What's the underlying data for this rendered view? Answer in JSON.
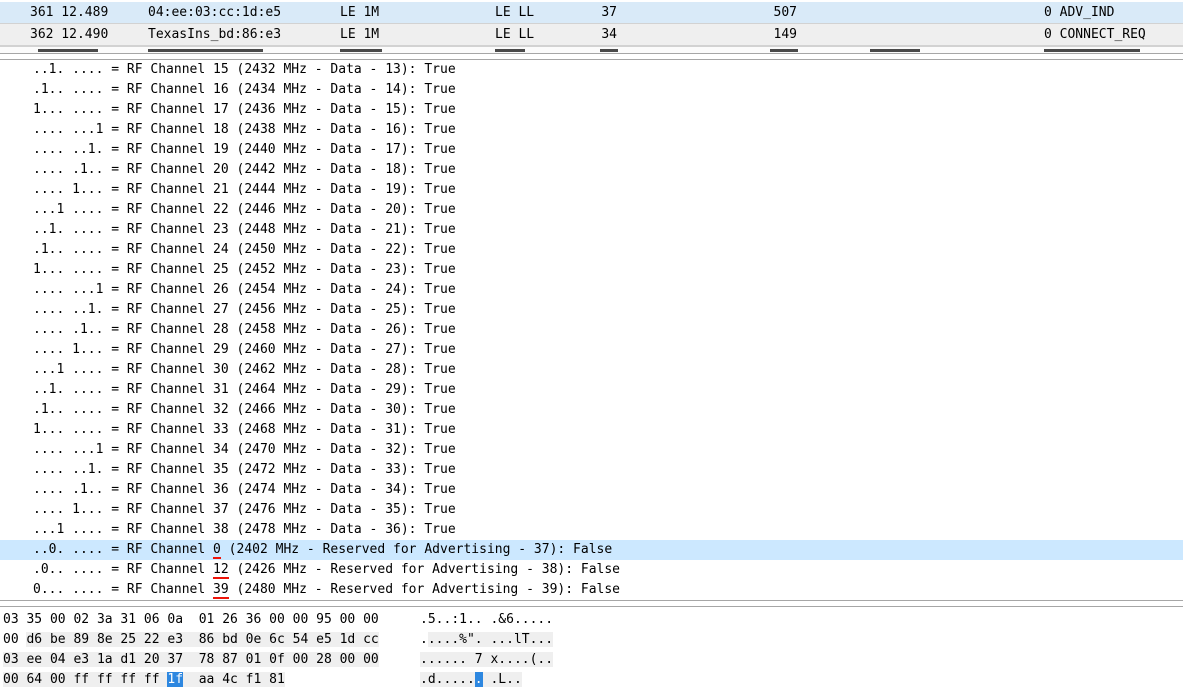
{
  "colors": {
    "row_blue": "#d9eaf8",
    "row_gray": "#efefef",
    "selected_row": "#cce8ff",
    "hex_field_gray": "#efefef",
    "hex_selected_blue": "#2d87e0",
    "annotation_red": "#ee1409"
  },
  "packet_list": {
    "rows": [
      {
        "no_time": "361 12.489",
        "source": "04:ee:03:cc:1d:e5",
        "phy": "LE 1M",
        "protocol": "LE LL",
        "length": "37",
        "length2": "507",
        "info": "0 ADV_IND",
        "highlight": "blue"
      },
      {
        "no_time": "362 12.490",
        "source": "TexasIns_bd:86:e3",
        "phy": "LE 1M",
        "protocol": "LE LL",
        "length": "34",
        "length2": "149",
        "info": "0 CONNECT_REQ",
        "highlight": "gray"
      }
    ]
  },
  "detail": {
    "rows": [
      {
        "prefix": "..1. .... = RF Channel ",
        "num": "15",
        "suffix": " (2432 MHz - Data - 13): True",
        "selected": false,
        "underline": false
      },
      {
        "prefix": ".1.. .... = RF Channel ",
        "num": "16",
        "suffix": " (2434 MHz - Data - 14): True",
        "selected": false,
        "underline": false
      },
      {
        "prefix": "1... .... = RF Channel ",
        "num": "17",
        "suffix": " (2436 MHz - Data - 15): True",
        "selected": false,
        "underline": false
      },
      {
        "prefix": ".... ...1 = RF Channel ",
        "num": "18",
        "suffix": " (2438 MHz - Data - 16): True",
        "selected": false,
        "underline": false
      },
      {
        "prefix": ".... ..1. = RF Channel ",
        "num": "19",
        "suffix": " (2440 MHz - Data - 17): True",
        "selected": false,
        "underline": false
      },
      {
        "prefix": ".... .1.. = RF Channel ",
        "num": "20",
        "suffix": " (2442 MHz - Data - 18): True",
        "selected": false,
        "underline": false
      },
      {
        "prefix": ".... 1... = RF Channel ",
        "num": "21",
        "suffix": " (2444 MHz - Data - 19): True",
        "selected": false,
        "underline": false
      },
      {
        "prefix": "...1 .... = RF Channel ",
        "num": "22",
        "suffix": " (2446 MHz - Data - 20): True",
        "selected": false,
        "underline": false
      },
      {
        "prefix": "..1. .... = RF Channel ",
        "num": "23",
        "suffix": " (2448 MHz - Data - 21): True",
        "selected": false,
        "underline": false
      },
      {
        "prefix": ".1.. .... = RF Channel ",
        "num": "24",
        "suffix": " (2450 MHz - Data - 22): True",
        "selected": false,
        "underline": false
      },
      {
        "prefix": "1... .... = RF Channel ",
        "num": "25",
        "suffix": " (2452 MHz - Data - 23): True",
        "selected": false,
        "underline": false
      },
      {
        "prefix": ".... ...1 = RF Channel ",
        "num": "26",
        "suffix": " (2454 MHz - Data - 24): True",
        "selected": false,
        "underline": false
      },
      {
        "prefix": ".... ..1. = RF Channel ",
        "num": "27",
        "suffix": " (2456 MHz - Data - 25): True",
        "selected": false,
        "underline": false
      },
      {
        "prefix": ".... .1.. = RF Channel ",
        "num": "28",
        "suffix": " (2458 MHz - Data - 26): True",
        "selected": false,
        "underline": false
      },
      {
        "prefix": ".... 1... = RF Channel ",
        "num": "29",
        "suffix": " (2460 MHz - Data - 27): True",
        "selected": false,
        "underline": false
      },
      {
        "prefix": "...1 .... = RF Channel ",
        "num": "30",
        "suffix": " (2462 MHz - Data - 28): True",
        "selected": false,
        "underline": false
      },
      {
        "prefix": "..1. .... = RF Channel ",
        "num": "31",
        "suffix": " (2464 MHz - Data - 29): True",
        "selected": false,
        "underline": false
      },
      {
        "prefix": ".1.. .... = RF Channel ",
        "num": "32",
        "suffix": " (2466 MHz - Data - 30): True",
        "selected": false,
        "underline": false
      },
      {
        "prefix": "1... .... = RF Channel ",
        "num": "33",
        "suffix": " (2468 MHz - Data - 31): True",
        "selected": false,
        "underline": false
      },
      {
        "prefix": ".... ...1 = RF Channel ",
        "num": "34",
        "suffix": " (2470 MHz - Data - 32): True",
        "selected": false,
        "underline": false
      },
      {
        "prefix": ".... ..1. = RF Channel ",
        "num": "35",
        "suffix": " (2472 MHz - Data - 33): True",
        "selected": false,
        "underline": false
      },
      {
        "prefix": ".... .1.. = RF Channel ",
        "num": "36",
        "suffix": " (2474 MHz - Data - 34): True",
        "selected": false,
        "underline": false
      },
      {
        "prefix": ".... 1... = RF Channel ",
        "num": "37",
        "suffix": " (2476 MHz - Data - 35): True",
        "selected": false,
        "underline": false
      },
      {
        "prefix": "...1 .... = RF Channel ",
        "num": "38",
        "suffix": " (2478 MHz - Data - 36): True",
        "selected": false,
        "underline": false
      },
      {
        "prefix": "..0. .... = RF Channel ",
        "num": "0",
        "suffix": " (2402 MHz - Reserved for Advertising - 37): False",
        "selected": true,
        "underline": true
      },
      {
        "prefix": ".0.. .... = RF Channel ",
        "num": "12",
        "suffix": " (2426 MHz - Reserved for Advertising - 38): False",
        "selected": false,
        "underline": true
      },
      {
        "prefix": "0... .... = RF Channel ",
        "num": "39",
        "suffix": " (2480 MHz - Reserved for Advertising - 39): False",
        "selected": false,
        "underline": true
      }
    ]
  },
  "hex": {
    "rows": [
      {
        "bytes": [
          "03",
          "35",
          "00",
          "02",
          "3a",
          "31",
          "06",
          "0a",
          "01",
          "26",
          "36",
          "00",
          "00",
          "95",
          "00",
          "00"
        ],
        "ascii": ".5..:1...&6.....",
        "gray": [
          -1,
          -1
        ],
        "blue": -1
      },
      {
        "bytes": [
          "00",
          "d6",
          "be",
          "89",
          "8e",
          "25",
          "22",
          "e3",
          "86",
          "bd",
          "0e",
          "6c",
          "54",
          "e5",
          "1d",
          "cc"
        ],
        "ascii": ".....%\"....lT...",
        "gray": [
          1,
          15
        ],
        "blue": -1
      },
      {
        "bytes": [
          "03",
          "ee",
          "04",
          "e3",
          "1a",
          "d1",
          "20",
          "37",
          "78",
          "87",
          "01",
          "0f",
          "00",
          "28",
          "00",
          "00"
        ],
        "ascii": "...... 7x....(..",
        "gray": [
          0,
          15
        ],
        "blue": -1
      },
      {
        "bytes": [
          "00",
          "64",
          "00",
          "ff",
          "ff",
          "ff",
          "ff",
          "1f",
          "aa",
          "4c",
          "f1",
          "81"
        ],
        "ascii": ".d.......L..",
        "gray": [
          0,
          11
        ],
        "blue": 7
      }
    ]
  }
}
